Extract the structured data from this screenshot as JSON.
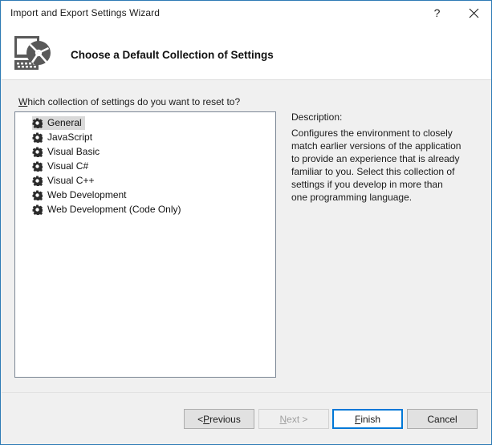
{
  "window": {
    "title": "Import and Export Settings Wizard",
    "help_icon": "question-mark-icon",
    "close_icon": "close-icon",
    "border_color": "#2e7bb5"
  },
  "header": {
    "icon": "settings-wizard-icon",
    "title": "Choose a Default Collection of Settings"
  },
  "main": {
    "prompt": {
      "accelerator": "W",
      "rest": "hich collection of settings do you want to reset to?"
    },
    "list": {
      "icon": "gear-icon",
      "selected_index": 0,
      "items": [
        {
          "label": "General"
        },
        {
          "label": "JavaScript"
        },
        {
          "label": "Visual Basic"
        },
        {
          "label": "Visual C#"
        },
        {
          "label": "Visual C++"
        },
        {
          "label": "Web Development"
        },
        {
          "label": "Web Development (Code Only)"
        }
      ]
    },
    "description": {
      "heading": "Description:",
      "text": "Configures the environment to closely match earlier versions of the application to provide an experience that is already familiar to you. Select this collection of settings if you develop in more than one programming language."
    }
  },
  "footer": {
    "previous": {
      "prefix": "< ",
      "accelerator": "P",
      "rest": "revious"
    },
    "next": {
      "accelerator": "N",
      "rest": "ext >",
      "disabled": true
    },
    "finish": {
      "accelerator": "F",
      "rest": "inish",
      "focused": true,
      "focus_color": "#0078d7"
    },
    "cancel": {
      "label": "Cancel"
    }
  }
}
